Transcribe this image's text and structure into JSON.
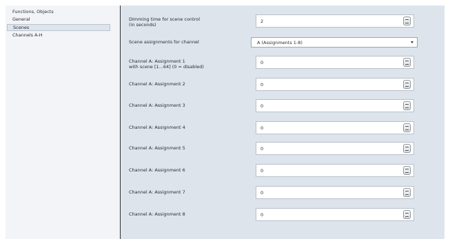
{
  "nav": {
    "items": [
      {
        "label": "Functions, Objects"
      },
      {
        "label": "General"
      },
      {
        "label": "Scenes"
      },
      {
        "label": "Channels A-H"
      }
    ],
    "selected_index": 2
  },
  "params": {
    "dimming_time": {
      "label_line1": "Dimming time for scene control",
      "label_line2": "(in seconds)",
      "value": "2"
    },
    "scene_assignments": {
      "label": "Scene assignments for channel",
      "value": "A (Assignments 1-8)"
    },
    "assignments": [
      {
        "label_line1": "Channel A:  Assignment 1",
        "label_line2": "with scene [1...64] (0 = disabled)",
        "value": "0"
      },
      {
        "label_line1": "Channel A:  Assignment 2",
        "value": "0"
      },
      {
        "label_line1": "Channel A:  Assignment 3",
        "value": "0"
      },
      {
        "label_line1": "Channel A:  Assignment 4",
        "value": "0"
      },
      {
        "label_line1": "Channel A:  Assignment 5",
        "value": "0"
      },
      {
        "label_line1": "Channel A:  Assignment 6",
        "value": "0"
      },
      {
        "label_line1": "Channel A:  Assignment 7",
        "value": "0"
      },
      {
        "label_line1": "Channel A:  Assignment 8",
        "value": "0"
      }
    ]
  },
  "colors": {
    "pane_background": "#dde4ec",
    "nav_background": "#f2f4f7",
    "selected_background": "#dfe5ec"
  },
  "icons": {
    "spin": "spin-button-icon",
    "dropdown": "chevron-down-icon"
  }
}
